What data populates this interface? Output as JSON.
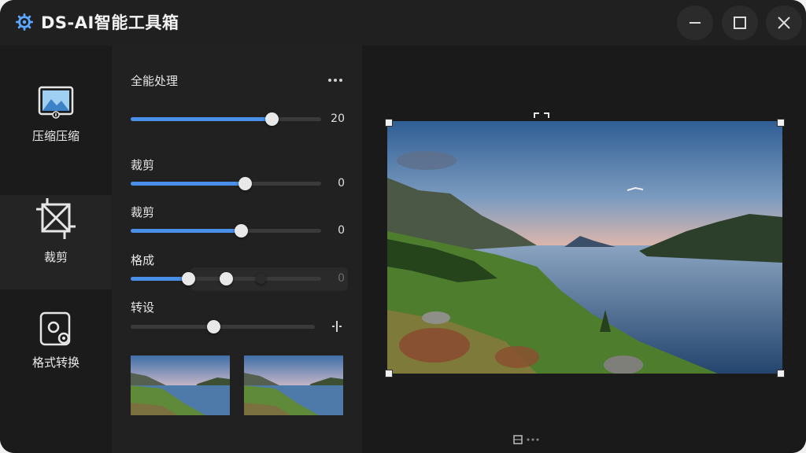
{
  "app": {
    "title": "DS-AI智能工具箱",
    "icon": "gear-icon",
    "accent": "#4a8fe8"
  },
  "window_controls": [
    "minimize-icon",
    "maximize-icon",
    "close-icon"
  ],
  "nav": {
    "items": [
      {
        "label": "压缩压缩",
        "icon": "image-compress-icon",
        "active": false
      },
      {
        "label": "裁剪",
        "icon": "crop-icon",
        "active": true
      },
      {
        "label": "格式转换",
        "icon": "format-convert-icon",
        "active": false
      }
    ]
  },
  "panel": {
    "title": "全能处理",
    "more_icon": "more-horizontal-icon",
    "sliders": [
      {
        "label": "",
        "value": "20",
        "fraction": 0.74
      },
      {
        "label": "裁剪",
        "value": "0",
        "fraction": 0.6
      },
      {
        "label": "裁剪",
        "value": "0",
        "fraction": 0.58
      },
      {
        "label": "格成",
        "value": "0",
        "fraction": 0.3,
        "extra_thumbs": [
          0.5,
          0.68
        ]
      },
      {
        "label": "转设",
        "value": "",
        "fraction": 0.45,
        "end_icon": "split-icon"
      }
    ],
    "thumbnails": [
      "landscape-thumbnail-1",
      "landscape-thumbnail-2"
    ]
  },
  "preview": {
    "image": "lake-landscape-photo",
    "fit_icon": "fullscreen-bracket-icon",
    "bottom_icon": "image-size-icon"
  }
}
